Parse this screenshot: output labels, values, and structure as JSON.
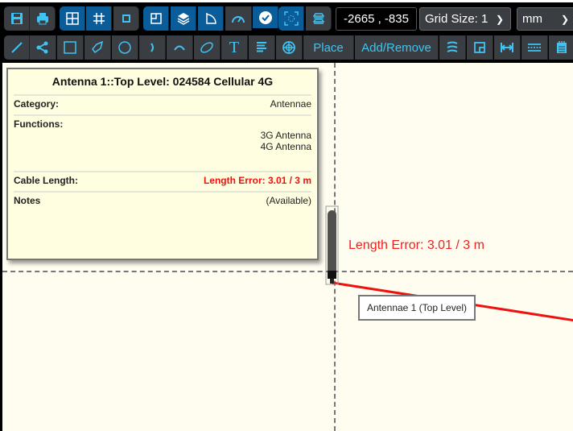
{
  "toolbar": {
    "coordinates": "-2665 , -835",
    "grid_size": "Grid Size: 1",
    "units": "mm",
    "place_label": "Place",
    "add_remove_label": "Add/Remove",
    "accent_color": "#3fc3f2",
    "active_color": "#0b5d9a"
  },
  "popup": {
    "title": "Antenna 1::Top Level: 024584 Cellular 4G",
    "rows": [
      {
        "label": "Category:",
        "value": "Antennae"
      },
      {
        "label": "Functions:",
        "values": [
          "3G Antenna",
          "4G Antenna"
        ]
      },
      {
        "label": "Cable Length:",
        "value": "Length Error: 3.01 / 3 m"
      },
      {
        "label": "Notes",
        "value": "(Available)"
      }
    ]
  },
  "canvas": {
    "error_text": "Length Error: 3.01 / 3 m",
    "component_label": "Antennae 1 (Top Level)",
    "error_color": "#f02020"
  }
}
